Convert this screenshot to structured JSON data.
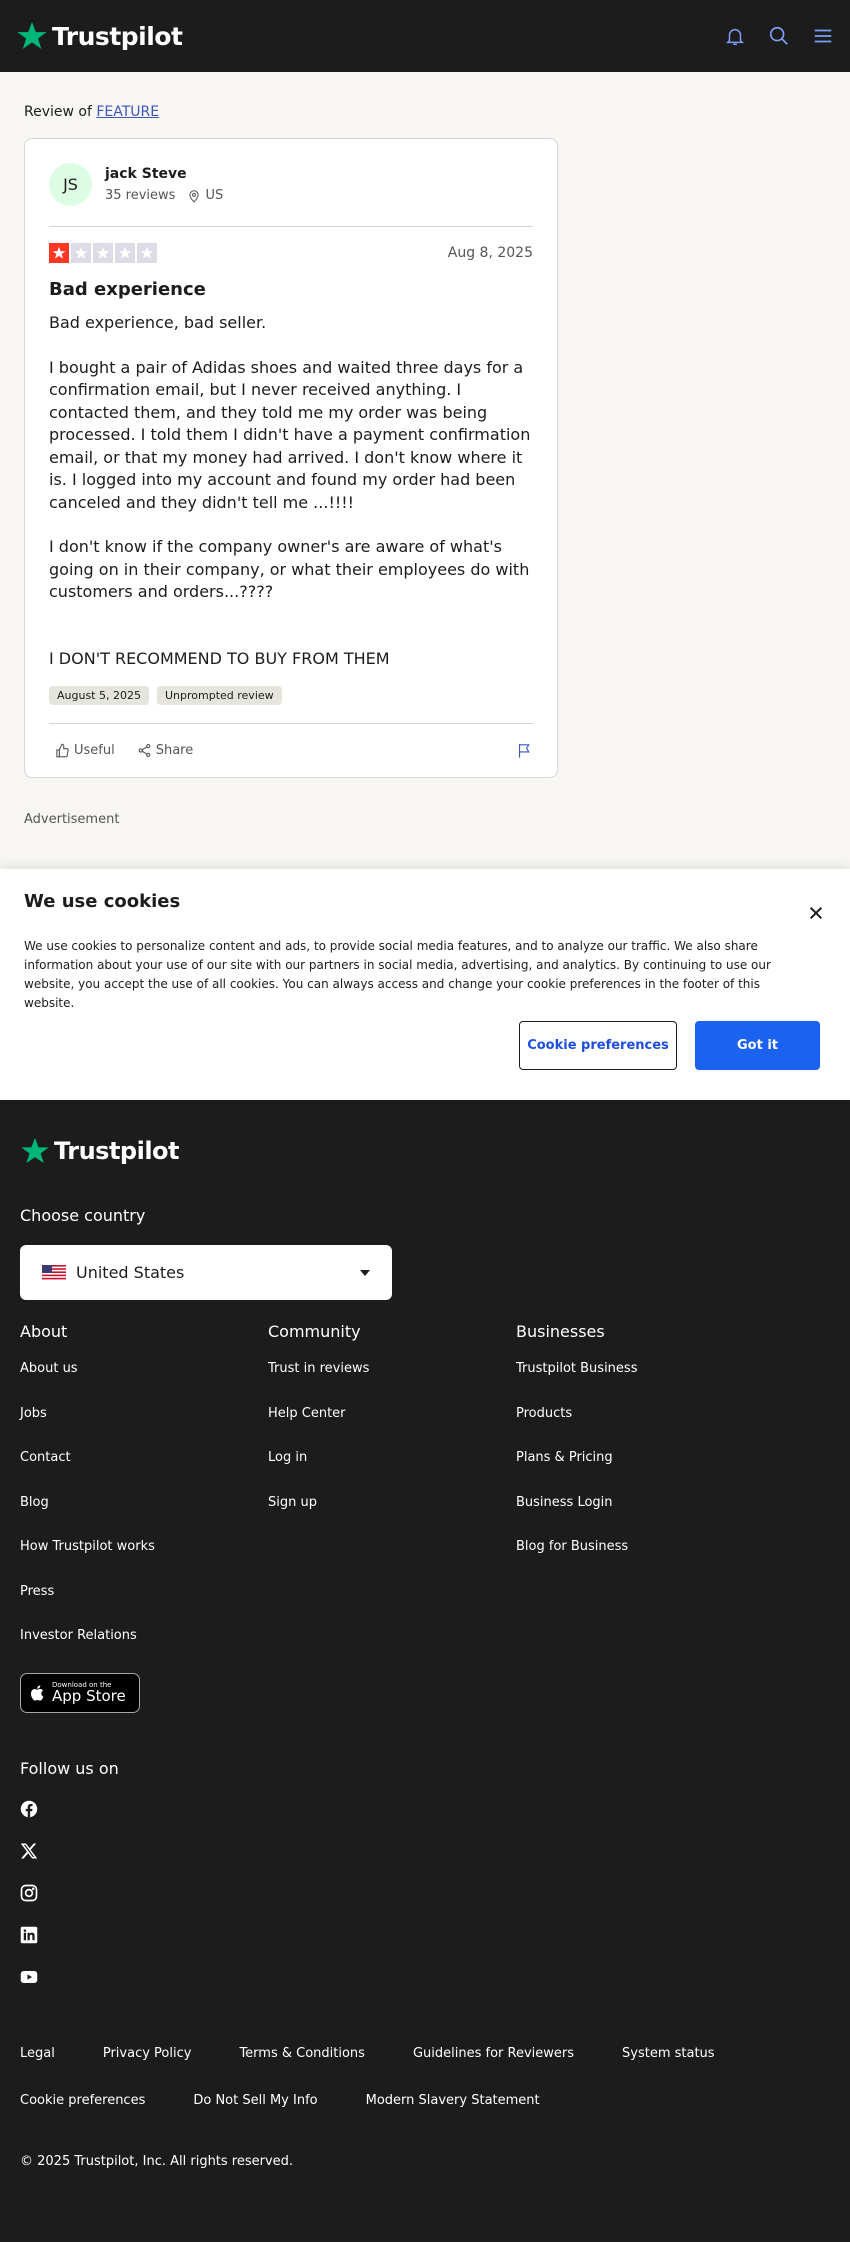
{
  "brand": {
    "name": "Trustpilot",
    "accent": "#00b67a",
    "star_red": "#ff3722"
  },
  "topbar": {
    "icons": [
      "bell-icon",
      "search-icon",
      "menu-icon"
    ]
  },
  "review_context": {
    "prefix": "Review of",
    "company": "FEATURE"
  },
  "review": {
    "user": {
      "initials": "JS",
      "name": "jack Steve",
      "reviews": "35 reviews",
      "country": "US"
    },
    "rating": 1,
    "date": "Aug 8, 2025",
    "title": "Bad experience",
    "paragraphs": [
      "Bad experience, bad seller.",
      "I bought a pair of Adidas shoes and waited three days for a confirmation email, but I never received anything. I contacted them, and they told me my order was being processed. I told them I didn't have a payment confirmation email, or that my money had arrived. I don't know where it is. I logged into my account and found my order had been canceled and they didn't tell me ...!!!!",
      "I don't know if the company owner's are aware of what's going on in their company, or what their employees do with customers and orders...????",
      "I DON'T RECOMMEND TO BUY FROM THEM"
    ],
    "tags": [
      "August 5, 2025",
      "Unprompted review"
    ],
    "actions": {
      "useful": "Useful",
      "share": "Share"
    }
  },
  "advertisement_label": "Advertisement",
  "cookie": {
    "title": "We use cookies",
    "text": "We use cookies to personalize content and ads, to provide social media features, and to analyze our traffic. We also share information about your use of our site with our partners in social media, advertising, and analytics. By continuing to use our website, you accept the use of all cookies. You can always access and change your cookie preferences in the footer of this website.",
    "pref_button": "Cookie preferences",
    "ok_button": "Got it"
  },
  "footer": {
    "choose_country": "Choose country",
    "country": "United States",
    "columns": [
      {
        "title": "About",
        "links": [
          "About us",
          "Jobs",
          "Contact",
          "Blog",
          "How Trustpilot works",
          "Press",
          "Investor Relations"
        ]
      },
      {
        "title": "Community",
        "links": [
          "Trust in reviews",
          "Help Center",
          "Log in",
          "Sign up"
        ]
      },
      {
        "title": "Businesses",
        "links": [
          "Trustpilot Business",
          "Products",
          "Plans & Pricing",
          "Business Login",
          "Blog for Business"
        ]
      }
    ],
    "app_store": {
      "small": "Download on the",
      "big": "App Store"
    },
    "follow": "Follow us on",
    "socials": [
      "facebook-icon",
      "x-icon",
      "instagram-icon",
      "linkedin-icon",
      "youtube-icon"
    ],
    "legal_row1": [
      "Legal",
      "Privacy Policy",
      "Terms & Conditions",
      "Guidelines for Reviewers",
      "System status"
    ],
    "legal_row2": [
      "Cookie preferences",
      "Do Not Sell My Info",
      "Modern Slavery Statement"
    ],
    "copyright": "© 2025 Trustpilot, Inc. All rights reserved."
  }
}
